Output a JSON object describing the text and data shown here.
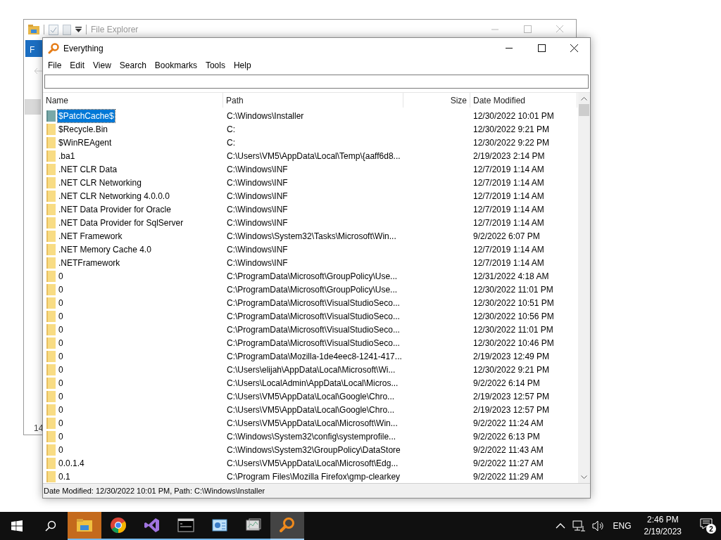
{
  "background_window": {
    "title": "File Explorer",
    "ribbon_tab": "F",
    "status_text": "14"
  },
  "window": {
    "title": "Everything"
  },
  "menu": [
    "File",
    "Edit",
    "View",
    "Search",
    "Bookmarks",
    "Tools",
    "Help"
  ],
  "columns": [
    "Name",
    "Path",
    "Size",
    "Date Modified"
  ],
  "rows": [
    {
      "name": "$PatchCache$",
      "path": "C:\\Windows\\Installer",
      "date": "12/30/2022 10:01 PM",
      "selected": true
    },
    {
      "name": "$Recycle.Bin",
      "path": "C:",
      "date": "12/30/2022 9:21 PM",
      "selected": false
    },
    {
      "name": "$WinREAgent",
      "path": "C:",
      "date": "12/30/2022 9:22 PM",
      "selected": false
    },
    {
      "name": ".ba1",
      "path": "C:\\Users\\VM5\\AppData\\Local\\Temp\\{aaff6d8...",
      "date": "2/19/2023 2:14 PM",
      "selected": false
    },
    {
      "name": ".NET CLR Data",
      "path": "C:\\Windows\\INF",
      "date": "12/7/2019 1:14 AM",
      "selected": false
    },
    {
      "name": ".NET CLR Networking",
      "path": "C:\\Windows\\INF",
      "date": "12/7/2019 1:14 AM",
      "selected": false
    },
    {
      "name": ".NET CLR Networking 4.0.0.0",
      "path": "C:\\Windows\\INF",
      "date": "12/7/2019 1:14 AM",
      "selected": false
    },
    {
      "name": ".NET Data Provider for Oracle",
      "path": "C:\\Windows\\INF",
      "date": "12/7/2019 1:14 AM",
      "selected": false
    },
    {
      "name": ".NET Data Provider for SqlServer",
      "path": "C:\\Windows\\INF",
      "date": "12/7/2019 1:14 AM",
      "selected": false
    },
    {
      "name": ".NET Framework",
      "path": "C:\\Windows\\System32\\Tasks\\Microsoft\\Win...",
      "date": "9/2/2022 6:07 PM",
      "selected": false
    },
    {
      "name": ".NET Memory Cache 4.0",
      "path": "C:\\Windows\\INF",
      "date": "12/7/2019 1:14 AM",
      "selected": false
    },
    {
      "name": ".NETFramework",
      "path": "C:\\Windows\\INF",
      "date": "12/7/2019 1:14 AM",
      "selected": false
    },
    {
      "name": "0",
      "path": "C:\\ProgramData\\Microsoft\\GroupPolicy\\Use...",
      "date": "12/31/2022 4:18 AM",
      "selected": false
    },
    {
      "name": "0",
      "path": "C:\\ProgramData\\Microsoft\\GroupPolicy\\Use...",
      "date": "12/30/2022 11:01 PM",
      "selected": false
    },
    {
      "name": "0",
      "path": "C:\\ProgramData\\Microsoft\\VisualStudioSeco...",
      "date": "12/30/2022 10:51 PM",
      "selected": false
    },
    {
      "name": "0",
      "path": "C:\\ProgramData\\Microsoft\\VisualStudioSeco...",
      "date": "12/30/2022 10:56 PM",
      "selected": false
    },
    {
      "name": "0",
      "path": "C:\\ProgramData\\Microsoft\\VisualStudioSeco...",
      "date": "12/30/2022 11:01 PM",
      "selected": false
    },
    {
      "name": "0",
      "path": "C:\\ProgramData\\Microsoft\\VisualStudioSeco...",
      "date": "12/30/2022 10:46 PM",
      "selected": false
    },
    {
      "name": "0",
      "path": "C:\\ProgramData\\Mozilla-1de4eec8-1241-417...",
      "date": "2/19/2023 12:49 PM",
      "selected": false
    },
    {
      "name": "0",
      "path": "C:\\Users\\elijah\\AppData\\Local\\Microsoft\\Wi...",
      "date": "12/30/2022 9:21 PM",
      "selected": false
    },
    {
      "name": "0",
      "path": "C:\\Users\\LocalAdmin\\AppData\\Local\\Micros...",
      "date": "9/2/2022 6:14 PM",
      "selected": false
    },
    {
      "name": "0",
      "path": "C:\\Users\\VM5\\AppData\\Local\\Google\\Chro...",
      "date": "2/19/2023 12:57 PM",
      "selected": false
    },
    {
      "name": "0",
      "path": "C:\\Users\\VM5\\AppData\\Local\\Google\\Chro...",
      "date": "2/19/2023 12:57 PM",
      "selected": false
    },
    {
      "name": "0",
      "path": "C:\\Users\\VM5\\AppData\\Local\\Microsoft\\Win...",
      "date": "9/2/2022 11:24 AM",
      "selected": false
    },
    {
      "name": "0",
      "path": "C:\\Windows\\System32\\config\\systemprofile...",
      "date": "9/2/2022 6:13 PM",
      "selected": false
    },
    {
      "name": "0",
      "path": "C:\\Windows\\System32\\GroupPolicy\\DataStore",
      "date": "9/2/2022 11:43 AM",
      "selected": false
    },
    {
      "name": "0.0.1.4",
      "path": "C:\\Users\\VM5\\AppData\\Local\\Microsoft\\Edg...",
      "date": "9/2/2022 11:27 AM",
      "selected": false
    },
    {
      "name": "0.1",
      "path": "C:\\Program Files\\Mozilla Firefox\\gmp-clearkey",
      "date": "9/2/2022 11:29 AM",
      "selected": false
    }
  ],
  "status_bar": "Date Modified: 12/30/2022 10:01 PM, Path: C:\\Windows\\Installer",
  "taskbar": {
    "apps": [
      {
        "kind": "explorer",
        "selected": false,
        "flashing": true
      },
      {
        "kind": "chrome",
        "selected": false,
        "flashing": false
      },
      {
        "kind": "visualstudio",
        "selected": false,
        "flashing": false
      },
      {
        "kind": "terminal",
        "selected": false,
        "flashing": false
      },
      {
        "kind": "control",
        "selected": false,
        "flashing": false
      },
      {
        "kind": "monitor",
        "selected": false,
        "flashing": false
      },
      {
        "kind": "everything",
        "selected": true,
        "flashing": false
      }
    ],
    "language": "ENG",
    "time": "2:46 PM",
    "date": "2/19/2023",
    "notifications": "2"
  }
}
